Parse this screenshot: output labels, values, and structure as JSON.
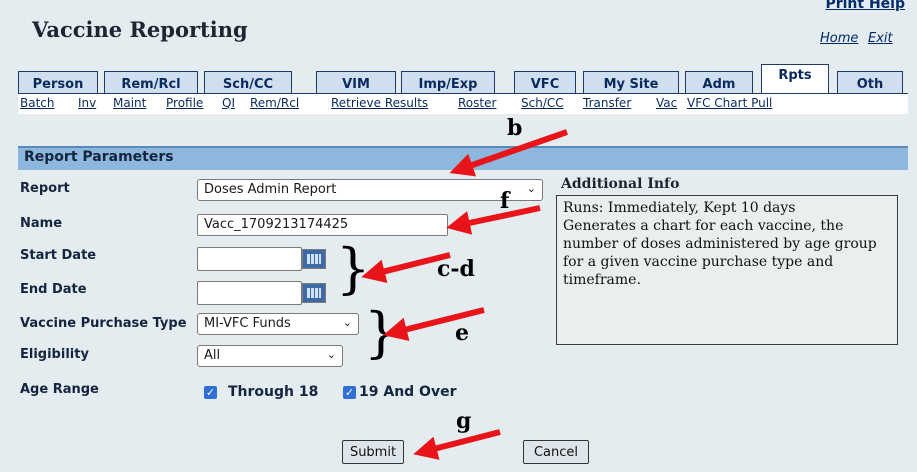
{
  "header": {
    "title": "Vaccine Reporting",
    "print_help": "Print Help",
    "home": "Home",
    "exit": "Exit"
  },
  "tabs": [
    "Person",
    "Rem/Rcl",
    "Sch/CC",
    "VIM",
    "Imp/Exp",
    "VFC",
    "My Site",
    "Adm",
    "Rpts",
    "Oth"
  ],
  "active_tab": "Rpts",
  "sub_links": [
    "Batch",
    "Inv",
    "Maint",
    "Profile",
    "QI",
    "Rem/Rcl",
    "Retrieve Results",
    "Roster",
    "Sch/CC",
    "Transfer",
    "Vac",
    "VFC Chart Pull"
  ],
  "report_params": {
    "section_title": "Report Parameters",
    "report_label": "Report",
    "report_value": "Doses Admin Report",
    "name_label": "Name",
    "name_value": "Vacc_1709213174425",
    "start_date_label": "Start Date",
    "start_date_value": "",
    "end_date_label": "End Date",
    "end_date_value": "",
    "purchase_type_label": "Vaccine Purchase Type",
    "purchase_type_value": "MI-VFC Funds",
    "eligibility_label": "Eligibility",
    "eligibility_value": "All",
    "age_range_label": "Age Range",
    "age_through_18": "Through 18",
    "age_19_over": "19 And Over"
  },
  "additional_info": {
    "title": "Additional Info",
    "lines": [
      "Runs: Immediately, Kept 10 days",
      "Generates a chart for each vaccine, the",
      "number of doses administered by age group",
      "for a given vaccine purchase type and",
      "timeframe."
    ]
  },
  "buttons": {
    "submit": "Submit",
    "cancel": "Cancel"
  },
  "annotations": {
    "b": "b",
    "f": "f",
    "cd": "c-d",
    "e": "e",
    "g": "g"
  },
  "colors": {
    "arrow": "#e8141a",
    "section_header": "#8db7dc",
    "tab_bg": "#cfdff0",
    "link": "#002b6b"
  },
  "icons": [
    "calendar-icon",
    "chevron-down-icon",
    "checkbox-checked-icon",
    "arrow-annotation"
  ]
}
